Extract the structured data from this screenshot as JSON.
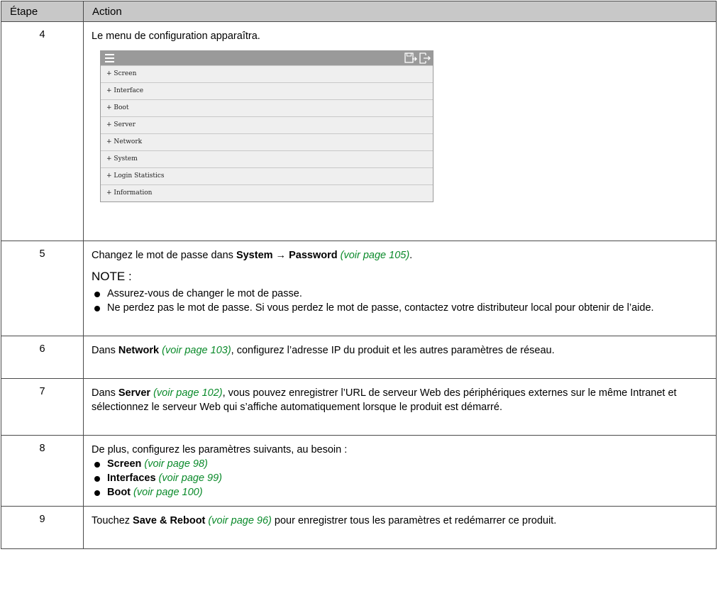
{
  "header": {
    "col1": "Étape",
    "col2": "Action"
  },
  "rows": {
    "r4": {
      "num": "4",
      "text": "Le menu de configuration apparaîtra.",
      "menu": [
        "+ Screen",
        "+ Interface",
        "+ Boot",
        "+ Server",
        "+ Network",
        "+ System",
        "+ Login Statistics",
        "+ Information"
      ],
      "icons": [
        "menu-icon",
        "save-icon",
        "logout-icon"
      ]
    },
    "r5": {
      "num": "5",
      "t1": "Changez le mot de passe dans ",
      "b1": "System",
      "arrow": " → ",
      "b2": "Password",
      "link": "(voir page 105)",
      "t2": ".",
      "note": "NOTE :",
      "bullet1": "Assurez-vous de changer le mot de passe.",
      "bullet2": "Ne perdez pas le mot de passe. Si vous perdez le mot de passe, contactez votre distributeur local pour obtenir de l’aide."
    },
    "r6": {
      "num": "6",
      "t1": "Dans ",
      "b1": "Network",
      "link": "(voir page 103)",
      "t2": ", configurez l’adresse IP du produit et les autres paramètres de réseau."
    },
    "r7": {
      "num": "7",
      "t1": "Dans ",
      "b1": "Server",
      "link": "(voir page 102)",
      "t2": ", vous pouvez enregistrer l’URL de serveur Web des périphériques externes sur le même Intranet et sélectionnez le serveur Web qui s’affiche automatiquement lorsque le produit est démarré."
    },
    "r8": {
      "num": "8",
      "t1": "De plus, configurez les paramètres suivants, au besoin :",
      "items": [
        {
          "b": "Screen",
          "link": "(voir page 98)"
        },
        {
          "b": "Interfaces",
          "link": "(voir page 99)"
        },
        {
          "b": "Boot",
          "link": "(voir page 100)"
        }
      ]
    },
    "r9": {
      "num": "9",
      "t1": "Touchez ",
      "b1": "Save & Reboot",
      "link": "(voir page 96)",
      "t2": " pour enregistrer tous les paramètres et redémarrer ce produit."
    }
  },
  "colors": {
    "header_bg": "#c8c8c8",
    "link": "#0a8a2a",
    "shot_bar": "#9a9a9a"
  }
}
